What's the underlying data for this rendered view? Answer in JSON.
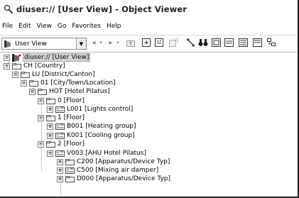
{
  "window": {
    "title": "diuser:// [User View] - Object Viewer"
  },
  "menu": {
    "items": [
      "File",
      "Edit",
      "View",
      "Go",
      "Favorites",
      "Help"
    ]
  },
  "toolbar": {
    "view_select_value": "User View",
    "buttons": [
      "back-arrow-icon",
      "forward-arrow-icon",
      "up-folder-icon",
      "copy-icon",
      "paste-icon",
      "properties-icon",
      "connect-icon",
      "binoculars-icon",
      "view-icon",
      "list-icon",
      "details-icon",
      "thumbnails-icon",
      "network-icon"
    ]
  },
  "tree": {
    "nodes": [
      {
        "label": "diuser:// [User View]",
        "expander": "⊟",
        "icon": "user-view-icon",
        "selected": true
      },
      {
        "label": "CH [Country]",
        "expander": "⊟",
        "icon": "folder-icon"
      },
      {
        "label": "LU [District/Canton]",
        "expander": "⊟",
        "icon": "folder-icon"
      },
      {
        "label": "01 [City/Town/Location]",
        "expander": "⊟",
        "icon": "folder-icon"
      },
      {
        "label": "HOT [Hotel Pilatus]",
        "expander": "⊟",
        "icon": "folder-icon"
      },
      {
        "label": "0 [Floor]",
        "expander": "⊟",
        "icon": "folder-icon"
      },
      {
        "label": "L001 [Lights control]",
        "expander": "⊞",
        "icon": "group-icon"
      },
      {
        "label": "1 [Floor]",
        "expander": "⊟",
        "icon": "folder-icon"
      },
      {
        "label": "B001 [Heating group]",
        "expander": "⊞",
        "icon": "group-icon"
      },
      {
        "label": "K001 [Cooling group]",
        "expander": "⊞",
        "icon": "group-icon"
      },
      {
        "label": "2 [Floor]",
        "expander": "⊟",
        "icon": "folder-icon"
      },
      {
        "label": "V003 [AHU Hotel Pilatus]",
        "expander": "⊟",
        "icon": "group-icon"
      },
      {
        "label": "C200 [Apparatus/Device Typ]",
        "expander": "⊞",
        "icon": "folder-icon"
      },
      {
        "label": "C500 [Mixing air damper]",
        "expander": "⊞",
        "icon": "group-icon"
      },
      {
        "label": "D000 [Apparatus/Device Typ]",
        "expander": "⊞",
        "icon": "folder-icon"
      }
    ]
  },
  "colors": {
    "selection": "#d4d4d4",
    "folder": "#f0f0f0",
    "border": "#202020"
  }
}
